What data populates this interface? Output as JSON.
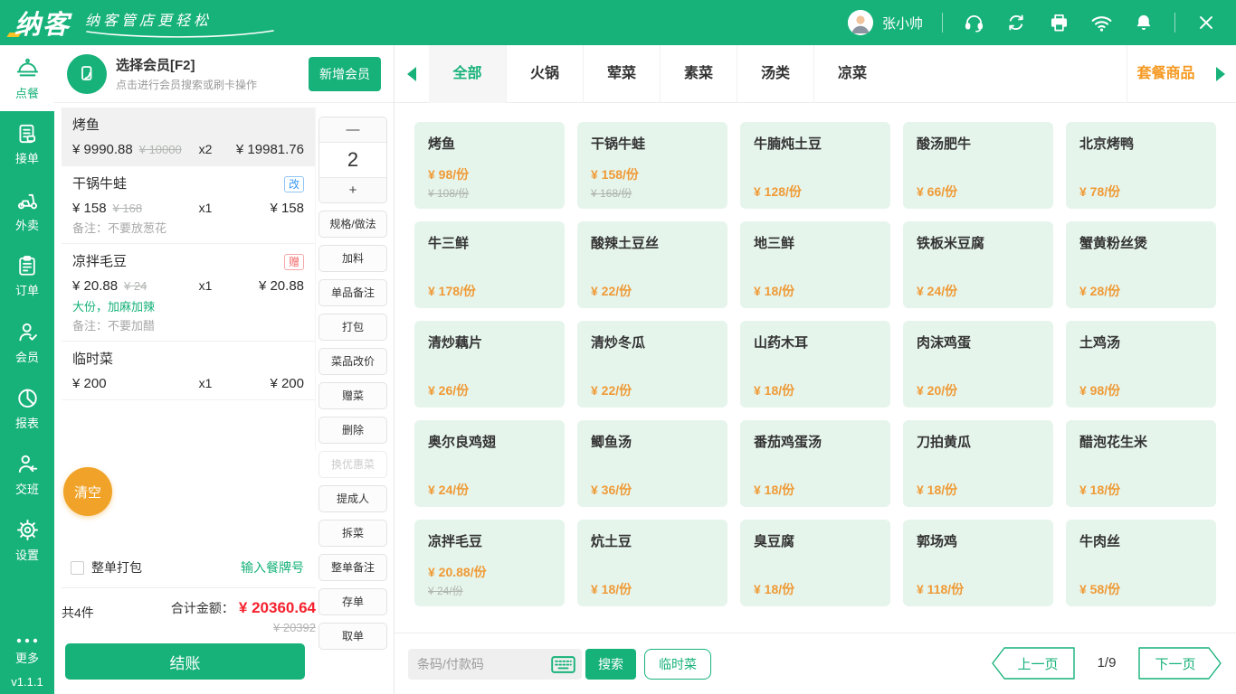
{
  "colors": {
    "brand_green": "#17b27a",
    "price_orange": "#ef9a36",
    "combo_orange": "#f59a23",
    "clear_orange": "#f0a328",
    "total_red": "#f5212d",
    "gift_red": "#f56c6c",
    "edit_blue": "#3d9df5",
    "card_mint": "#e6f5ec"
  },
  "icons": {
    "topbar": [
      "headset",
      "sync",
      "printer",
      "wifi",
      "bell",
      "close"
    ],
    "sidebar": [
      "cloche",
      "receipt",
      "scooter",
      "clipboard",
      "member",
      "pie",
      "shift",
      "gear",
      "dots"
    ],
    "misc": [
      "member-card",
      "keyboard",
      "arrow-left",
      "arrow-right",
      "checkbox"
    ]
  },
  "topbar": {
    "logo": "纳客",
    "slogan": "纳客管店更轻松",
    "user": "张小帅"
  },
  "sidebar": {
    "items": [
      {
        "key": "ordering",
        "icon": "cloche",
        "label": "点餐",
        "active": true
      },
      {
        "key": "accept-orders",
        "icon": "receipt",
        "label": "接单"
      },
      {
        "key": "takeout",
        "icon": "scooter",
        "label": "外卖"
      },
      {
        "key": "orders",
        "icon": "clipboard",
        "label": "订单"
      },
      {
        "key": "members",
        "icon": "member",
        "label": "会员"
      },
      {
        "key": "reports",
        "icon": "pie",
        "label": "报表"
      },
      {
        "key": "shift",
        "icon": "shift",
        "label": "交班"
      },
      {
        "key": "settings",
        "icon": "gear",
        "label": "设置"
      }
    ],
    "more_label": "更多",
    "version": "v1.1.1"
  },
  "member_bar": {
    "title": "选择会员[F2]",
    "subtitle": "点击进行会员搜索或刷卡操作",
    "add_button": "新增会员"
  },
  "order": {
    "items": [
      {
        "name": "烤鱼",
        "price": "¥ 9990.88",
        "orig_price": "¥ 10000",
        "qty": "x2",
        "total": "¥ 19981.76",
        "selected": true
      },
      {
        "name": "干锅牛蛙",
        "badge": "改",
        "badge_type": "blue",
        "price": "¥ 158",
        "orig_price": "¥ 168",
        "qty": "x1",
        "total": "¥ 158",
        "note": "备注：不要放葱花"
      },
      {
        "name": "凉拌毛豆",
        "badge": "赠",
        "badge_type": "red",
        "price": "¥ 20.88",
        "orig_price": "¥ 24",
        "qty": "x1",
        "total": "¥ 20.88",
        "spec": "大份，加麻加辣",
        "note": "备注：不要加醋"
      },
      {
        "name": "临时菜",
        "price": "¥ 200",
        "qty": "x1",
        "total": "¥ 200"
      }
    ],
    "clear_button": "清空",
    "pack_label": "整单打包",
    "table_no_link": "输入餐牌号",
    "count_label": "共4件",
    "total_label": "合计金额：",
    "total_value": "¥ 20360.64",
    "total_orig": "¥ 20392",
    "checkout_button": "结账"
  },
  "actions": {
    "minus_label": "—",
    "qty_value": "2",
    "plus_label": "+",
    "buttons": [
      {
        "key": "spec-method",
        "label": "规格/做法"
      },
      {
        "key": "add-ingredient",
        "label": "加料"
      },
      {
        "key": "item-note",
        "label": "单品备注"
      },
      {
        "key": "pack",
        "label": "打包"
      },
      {
        "key": "change-price",
        "label": "菜品改价"
      },
      {
        "key": "gift-dish",
        "label": "赠菜"
      },
      {
        "key": "delete",
        "label": "删除"
      },
      {
        "key": "swap-discount",
        "label": "换优惠菜",
        "disabled": true
      },
      {
        "key": "commission-person",
        "label": "提成人"
      },
      {
        "key": "split-dish",
        "label": "拆菜"
      },
      {
        "key": "order-note",
        "label": "整单备注"
      },
      {
        "key": "save-order",
        "label": "存单"
      },
      {
        "key": "retrieve-order",
        "label": "取单"
      }
    ]
  },
  "categories": {
    "tabs": [
      {
        "key": "all",
        "label": "全部",
        "active": true
      },
      {
        "key": "hotpot",
        "label": "火锅"
      },
      {
        "key": "meat-dish",
        "label": "荤菜"
      },
      {
        "key": "veg-dish",
        "label": "素菜"
      },
      {
        "key": "soup",
        "label": "汤类"
      },
      {
        "key": "cold-dish",
        "label": "凉菜"
      }
    ],
    "combo_label": "套餐商品"
  },
  "menu": {
    "items": [
      {
        "name": "烤鱼",
        "price": "¥ 98/份",
        "orig_price": "¥ 108/份"
      },
      {
        "name": "干锅牛蛙",
        "price": "¥ 158/份",
        "orig_price": "¥ 168/份"
      },
      {
        "name": "牛腩炖土豆",
        "price": "¥ 128/份"
      },
      {
        "name": "酸汤肥牛",
        "price": "¥ 66/份"
      },
      {
        "name": "北京烤鸭",
        "price": "¥ 78/份"
      },
      {
        "name": "牛三鲜",
        "price": "¥ 178/份"
      },
      {
        "name": "酸辣土豆丝",
        "price": "¥ 22/份"
      },
      {
        "name": "地三鲜",
        "price": "¥ 18/份"
      },
      {
        "name": "铁板米豆腐",
        "price": "¥ 24/份"
      },
      {
        "name": "蟹黄粉丝煲",
        "price": "¥ 28/份"
      },
      {
        "name": "清炒藕片",
        "price": "¥ 26/份"
      },
      {
        "name": "清炒冬瓜",
        "price": "¥ 22/份"
      },
      {
        "name": "山药木耳",
        "price": "¥ 18/份"
      },
      {
        "name": "肉沫鸡蛋",
        "price": "¥ 20/份"
      },
      {
        "name": "土鸡汤",
        "price": "¥ 98/份"
      },
      {
        "name": "奥尔良鸡翅",
        "price": "¥ 24/份"
      },
      {
        "name": "鲫鱼汤",
        "price": "¥ 36/份"
      },
      {
        "name": "番茄鸡蛋汤",
        "price": "¥ 18/份"
      },
      {
        "name": "刀拍黄瓜",
        "price": "¥ 18/份"
      },
      {
        "name": "醋泡花生米",
        "price": "¥ 18/份"
      },
      {
        "name": "凉拌毛豆",
        "price": "¥ 20.88/份",
        "orig_price": "¥ 24/份"
      },
      {
        "name": "炕土豆",
        "price": "¥ 18/份"
      },
      {
        "name": "臭豆腐",
        "price": "¥ 18/份"
      },
      {
        "name": "郭场鸡",
        "price": "¥ 118/份"
      },
      {
        "name": "牛肉丝",
        "price": "¥ 58/份"
      }
    ]
  },
  "bottombar": {
    "search_placeholder": "条码/付款码",
    "search_button": "搜索",
    "temp_dish_button": "临时菜",
    "prev_label": "上一页",
    "page_indicator": "1/9",
    "next_label": "下一页"
  }
}
